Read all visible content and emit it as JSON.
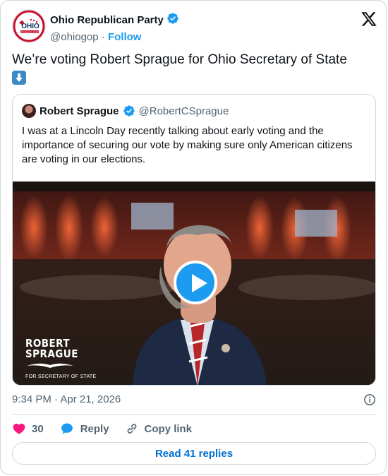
{
  "colors": {
    "accent": "#1d9bf0",
    "like": "#f91880",
    "muted": "#536471",
    "border": "#cfd9de"
  },
  "author": {
    "name": "Ohio Republican Party",
    "handle": "@ohiogop",
    "separator": "·",
    "follow_label": "Follow",
    "avatar_text": "OHIO",
    "avatar_subtext": "REPUBLICAN PARTY",
    "verified": true
  },
  "tweet": {
    "text": "We’re voting Robert Sprague for Ohio Secretary of State",
    "emoji": "down-arrow-icon"
  },
  "quoted": {
    "name": "Robert Sprague",
    "handle": "@RobertCSprague",
    "verified": true,
    "text": "I was at a Lincoln Day recently talking about early voting and the importance of securing our vote by making sure only American citizens are voting in our elections.",
    "video": {
      "overlay_title_1": "ROBERT",
      "overlay_title_2": "SPRAGUE",
      "overlay_subtitle": "FOR SECRETARY OF STATE"
    }
  },
  "meta": {
    "timestamp": "9:34 PM · Apr 21, 2026"
  },
  "actions": {
    "like_count": "30",
    "reply_label": "Reply",
    "copy_link_label": "Copy link"
  },
  "footer": {
    "read_replies_label": "Read 41 replies"
  }
}
